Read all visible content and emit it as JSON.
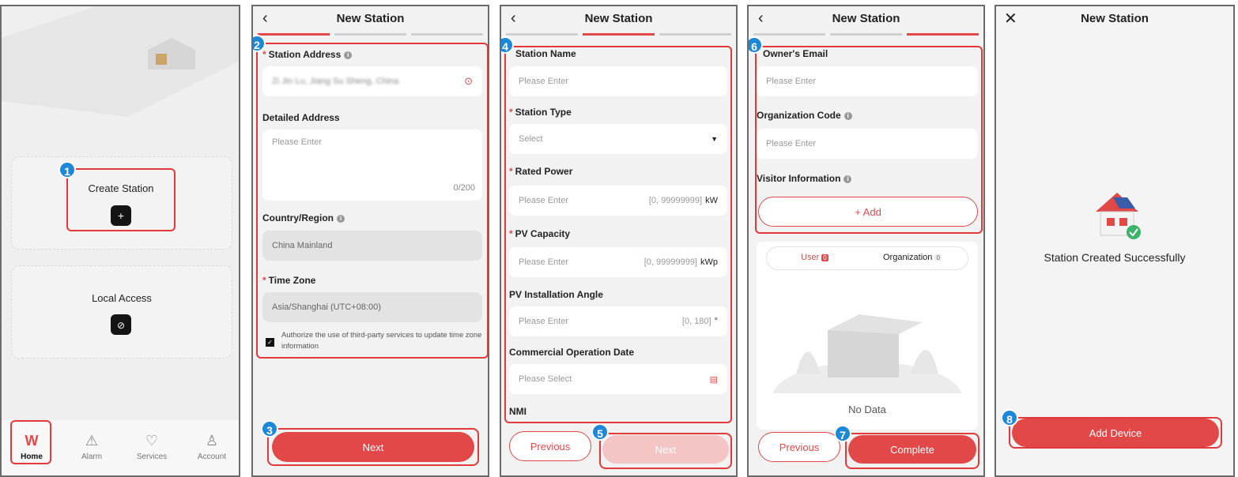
{
  "home": {
    "create_station": "Create Station",
    "local_access": "Local Access",
    "tabs": [
      {
        "label": "Home",
        "icon": "home-icon"
      },
      {
        "label": "Alarm",
        "icon": "alarm-icon"
      },
      {
        "label": "Services",
        "icon": "services-icon"
      },
      {
        "label": "Account",
        "icon": "account-icon"
      }
    ]
  },
  "header": {
    "title": "New Station"
  },
  "step1": {
    "station_address_label": "Station Address",
    "station_address_value": "Zi Jin Lu, Jiang Su Sheng, China",
    "detailed_address_label": "Detailed Address",
    "detailed_address_placeholder": "Please Enter",
    "counter": "0/200",
    "country_label": "Country/Region",
    "country_value": "China Mainland",
    "timezone_label": "Time Zone",
    "timezone_value": "Asia/Shanghai (UTC+08:00)",
    "authorize_text": "Authorize the use of third-party services to update time zone information",
    "next": "Next"
  },
  "step2": {
    "station_name_label": "Station Name",
    "station_name_placeholder": "Please Enter",
    "station_type_label": "Station Type",
    "station_type_placeholder": "Select",
    "rated_power_label": "Rated Power",
    "rated_power_placeholder": "Please Enter",
    "rated_power_range": "[0, 99999999]",
    "rated_power_unit": "kW",
    "pv_capacity_label": "PV Capacity",
    "pv_capacity_placeholder": "Please Enter",
    "pv_capacity_range": "[0, 99999999]",
    "pv_capacity_unit": "kWp",
    "pv_angle_label": "PV Installation Angle",
    "pv_angle_placeholder": "Please Enter",
    "pv_angle_range": "[0, 180]",
    "pv_angle_unit": "°",
    "cod_label": "Commercial Operation Date",
    "cod_placeholder": "Please Select",
    "nmi_label": "NMI",
    "previous": "Previous",
    "next": "Next"
  },
  "step3": {
    "owner_email_label": "Owner's Email",
    "owner_email_placeholder": "Please Enter",
    "org_code_label": "Organization Code",
    "org_code_placeholder": "Please Enter",
    "visitor_label": "Visitor Information",
    "add": "+ Add",
    "user_tab": "User",
    "user_count": "0",
    "org_tab": "Organization",
    "org_count": "0",
    "no_data": "No Data",
    "previous": "Previous",
    "complete": "Complete"
  },
  "success": {
    "message": "Station Created Successfully",
    "add_device": "Add Device"
  },
  "badges": [
    "1",
    "2",
    "3",
    "4",
    "5",
    "6",
    "7",
    "8"
  ],
  "colors": {
    "accent": "#e24848",
    "badge": "#1e88d8",
    "highlight": "#e23a3a"
  }
}
